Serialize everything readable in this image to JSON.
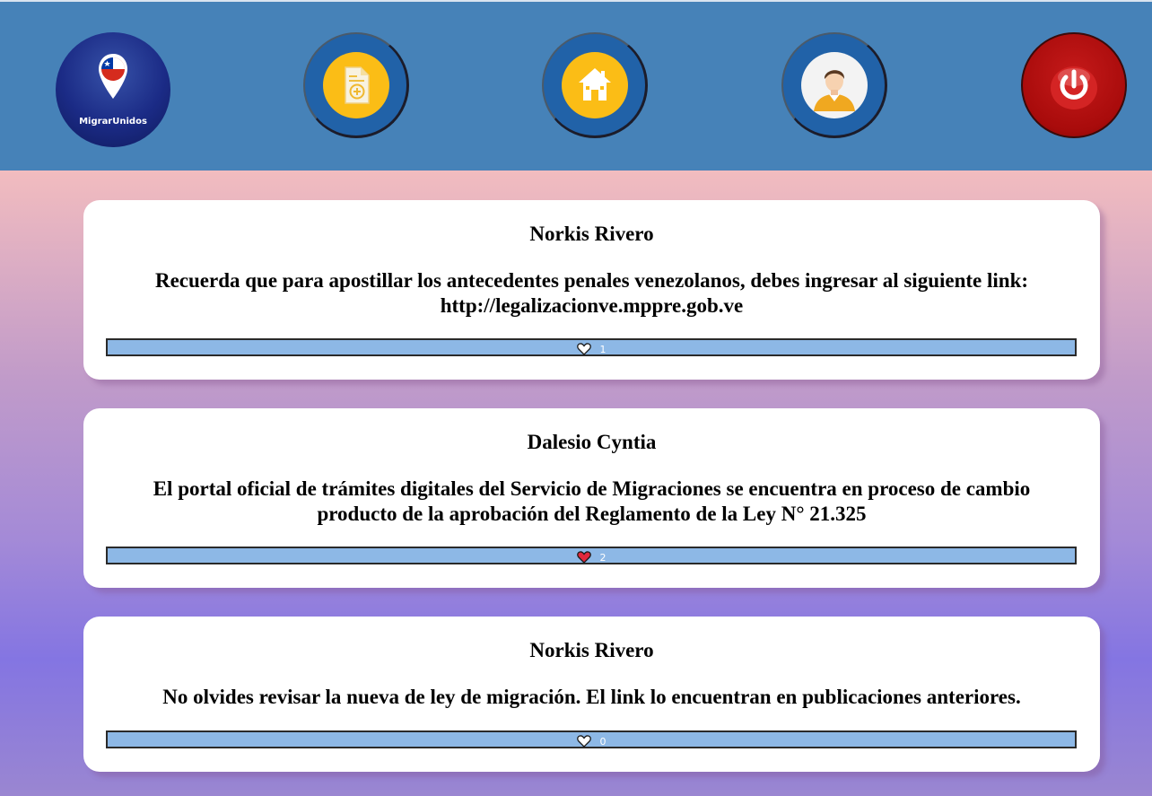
{
  "header": {
    "logo_text": "MigrarUnidos",
    "nav": [
      {
        "name": "new-document",
        "icon": "document-plus-icon"
      },
      {
        "name": "home",
        "icon": "home-icon"
      },
      {
        "name": "profile",
        "icon": "user-avatar-icon"
      },
      {
        "name": "logout",
        "icon": "power-icon"
      }
    ],
    "colors": {
      "bar": "#4682b8",
      "button": "#2162a8",
      "icon_bg": "#fbbd16",
      "power": "#a80b0b"
    }
  },
  "posts": [
    {
      "author": "Norkis Rivero",
      "text": "Recuerda que para apostillar los antecedentes penales venezolanos, debes ingresar al siguiente link: http://legalizacionve.mppre.gob.ve",
      "likes": "1",
      "liked": false
    },
    {
      "author": "Dalesio Cyntia",
      "text": "El portal oficial de trámites digitales del Servicio de Migraciones se encuentra en proceso de cambio producto de la aprobación del Reglamento de la Ley N° 21.325",
      "likes": "2",
      "liked": true
    },
    {
      "author": "Norkis Rivero",
      "text": "No olvides revisar la nueva de ley de migración. El link lo encuentran en publicaciones anteriores.",
      "likes": "0",
      "liked": false
    }
  ]
}
